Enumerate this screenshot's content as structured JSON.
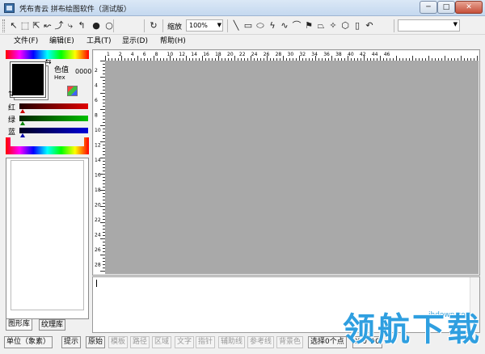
{
  "window": {
    "title": "凭布青云 拼布绘图软件（测试版）",
    "minimize_glyph": "─",
    "maximize_glyph": "□",
    "close_glyph": "✕"
  },
  "toolbar": {
    "zoom_label": "缩放",
    "zoom_value": "100%",
    "combo_value": "",
    "tools": [
      {
        "name": "select-arrow-tool",
        "glyph": "↖"
      },
      {
        "name": "rect-select-tool",
        "glyph": "⬚"
      },
      {
        "name": "node-arrow-tool",
        "glyph": "⇱"
      },
      {
        "name": "point-move-tool",
        "glyph": "↜"
      },
      {
        "name": "curve-edit-tool",
        "glyph": "⤴"
      },
      {
        "name": "copy-arrow-tool",
        "glyph": "⤷"
      },
      {
        "name": "rotate-arrow-tool",
        "glyph": "↰"
      },
      {
        "name": "fill-dot-tool",
        "glyph": "●"
      },
      {
        "name": "empty-circle-tool",
        "glyph": "○"
      },
      {
        "name": "refresh-tool",
        "glyph": "↻"
      },
      {
        "name": "line-tool",
        "glyph": "╲"
      },
      {
        "name": "rectangle-tool",
        "glyph": "▭"
      },
      {
        "name": "ellipse-tool",
        "glyph": "⬭"
      },
      {
        "name": "polyline-tool",
        "glyph": "ϟ"
      },
      {
        "name": "curve-tool",
        "glyph": "∿"
      },
      {
        "name": "arc-tool",
        "glyph": "⌒"
      },
      {
        "name": "flag-tool",
        "glyph": "⚑"
      },
      {
        "name": "trapezoid-tool",
        "glyph": "⏢"
      },
      {
        "name": "star-tool",
        "glyph": "✧"
      },
      {
        "name": "hexagon-tool",
        "glyph": "⬡"
      },
      {
        "name": "cylinder-tool",
        "glyph": "▯"
      },
      {
        "name": "undo-tool",
        "glyph": "↶"
      }
    ]
  },
  "menu": {
    "items": [
      "文件(F)",
      "编辑(E)",
      "工具(T)",
      "显示(D)",
      "帮助(H)"
    ]
  },
  "color_panel": {
    "color_value_label": "色值",
    "hex_label": "Hex",
    "hex_value": "0000",
    "red_label": "红",
    "green_label": "绿",
    "blue_label": "蓝",
    "swap_glyph": "⇆",
    "reset_glyph": "⇅"
  },
  "panel_tabs": [
    "图形库",
    "纹理库"
  ],
  "ruler": {
    "top_labels": [
      "1",
      "2",
      "4",
      "6",
      "8",
      "10",
      "12",
      "14",
      "16",
      "18",
      "20",
      "22",
      "24",
      "26",
      "28",
      "30",
      "32",
      "34",
      "36",
      "38",
      "40",
      "42",
      "44",
      "46"
    ],
    "left_labels": [
      "2",
      "4",
      "6",
      "8",
      "10",
      "12",
      "14",
      "16",
      "18",
      "20",
      "22",
      "24",
      "26",
      "28"
    ]
  },
  "statusbar": {
    "items": [
      {
        "label": "单位（象素）",
        "enabled": true
      },
      {
        "label": "提示",
        "enabled": true
      },
      {
        "label": "原始",
        "enabled": true
      },
      {
        "label": "模板",
        "enabled": false
      },
      {
        "label": "路径",
        "enabled": false
      },
      {
        "label": "区域",
        "enabled": false
      },
      {
        "label": "文字",
        "enabled": false
      },
      {
        "label": "指针",
        "enabled": false
      },
      {
        "label": "辅助线",
        "enabled": false
      },
      {
        "label": "参考线",
        "enabled": false
      },
      {
        "label": "背景色",
        "enabled": false
      },
      {
        "label": "选择0个点",
        "enabled": true
      },
      {
        "label": "X:0 Y:0",
        "enabled": true
      }
    ]
  },
  "watermark": {
    "url": "ihdown.com",
    "logo_text": "领航下载"
  },
  "colors": {
    "canvas": "#a9a9a9",
    "foreground": "#000000",
    "background": "#ffffff"
  }
}
